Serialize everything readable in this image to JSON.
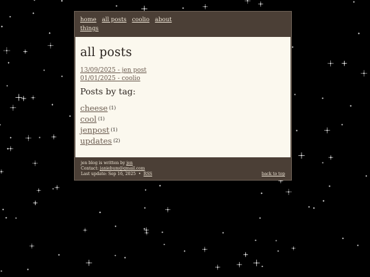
{
  "nav": {
    "items": [
      {
        "label": "home"
      },
      {
        "label": "all posts"
      },
      {
        "label": "coolio"
      },
      {
        "label": "about"
      },
      {
        "label": "things"
      }
    ]
  },
  "page": {
    "title": "all posts",
    "posts": [
      {
        "label": "13/09/2025 - jen post"
      },
      {
        "label": "01/01/2025 - coolio"
      }
    ],
    "tags_heading": "Posts by tag:",
    "tags": [
      {
        "name": "cheese",
        "count": "(1)"
      },
      {
        "name": "cool",
        "count": "(1)"
      },
      {
        "name": "jenpost",
        "count": "(1)"
      },
      {
        "name": "updates",
        "count": "(2)"
      }
    ]
  },
  "footer": {
    "line1_text": "jen blog is written by",
    "author_link": "jen",
    "line2_text": "Contact:",
    "email_link": "janiebum@gmail.com",
    "line3_text": "Last update: Sep 16, 2025",
    "separator": "•",
    "rss_link": "RSS",
    "back_to_top": "back to top"
  },
  "colors": {
    "frame": "#4b3f36",
    "content_bg": "#fbf8ee",
    "link": "#6a5a4e",
    "sky": "#000000"
  }
}
